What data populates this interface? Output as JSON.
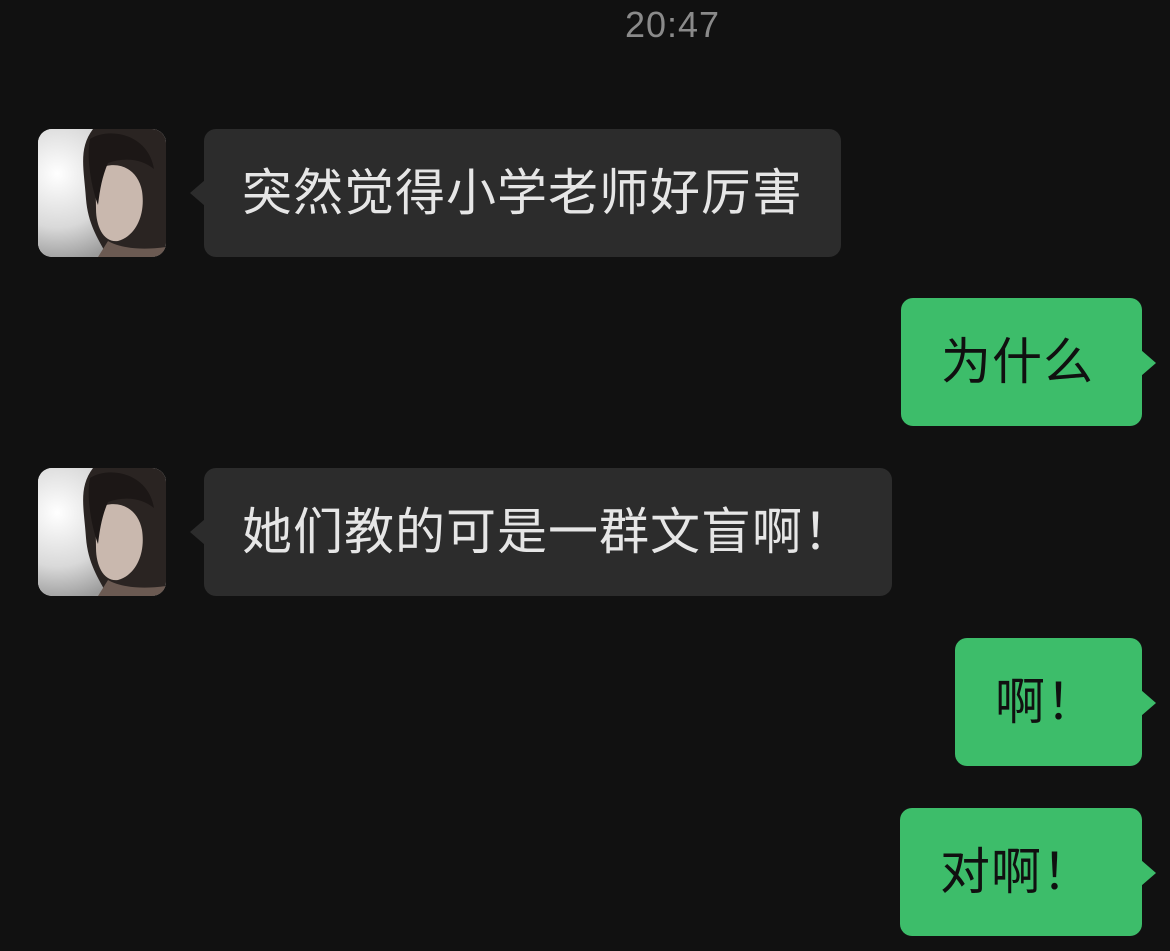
{
  "chat": {
    "timestamp": "20:47",
    "messages": [
      {
        "sender": "other",
        "text": "突然觉得小学老师好厉害",
        "avatar": "contact-avatar"
      },
      {
        "sender": "me",
        "text": "为什么"
      },
      {
        "sender": "other",
        "text": "她们教的可是一群文盲啊！",
        "avatar": "contact-avatar"
      },
      {
        "sender": "me",
        "text": "啊！"
      },
      {
        "sender": "me",
        "text": "对啊！"
      }
    ]
  },
  "colors": {
    "background": "#111111",
    "incoming_bubble": "#2c2c2c",
    "outgoing_bubble": "#3dbd6a",
    "timestamp_text": "#8a8a8a"
  }
}
